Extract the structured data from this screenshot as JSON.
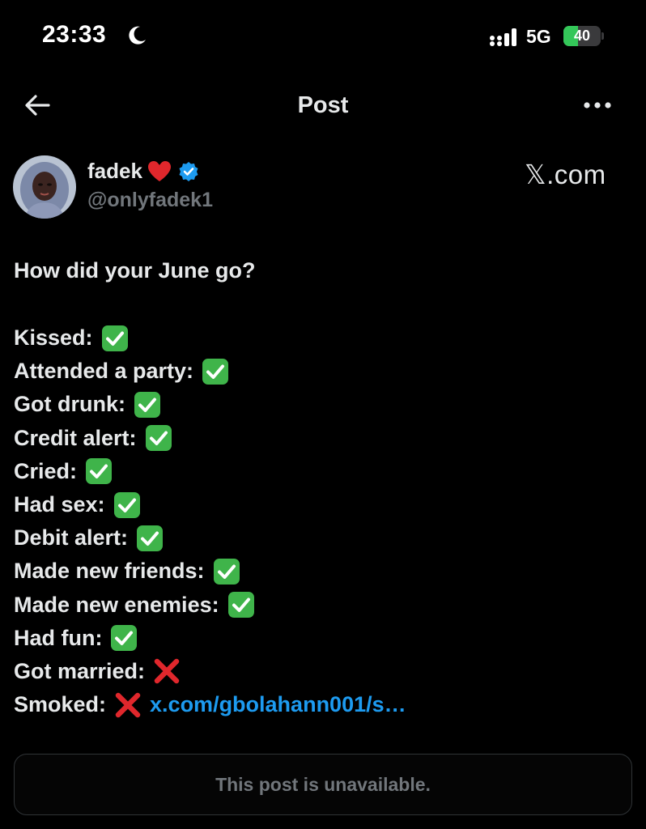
{
  "status_bar": {
    "time": "23:33",
    "network": "5G",
    "battery": "40",
    "battery_level": 0.4,
    "icons": [
      "moon-icon",
      "signal-icon",
      "battery-icon"
    ]
  },
  "nav": {
    "title": "Post",
    "icons": [
      "back-arrow-icon",
      "more-icon"
    ]
  },
  "author": {
    "name": "fadek",
    "handle": "@onlyfadek1",
    "icons": [
      "heart-icon",
      "verified-icon"
    ]
  },
  "watermark": "𝕏.com",
  "post": {
    "question": "How did your June go?",
    "items": [
      {
        "label": "Kissed:",
        "mark": "check"
      },
      {
        "label": "Attended a party:",
        "mark": "check"
      },
      {
        "label": "Got drunk:",
        "mark": "check"
      },
      {
        "label": "Credit alert:",
        "mark": "check"
      },
      {
        "label": "Cried:",
        "mark": "check"
      },
      {
        "label": "Had sex:",
        "mark": "check"
      },
      {
        "label": "Debit alert:",
        "mark": "check"
      },
      {
        "label": "Made new friends:",
        "mark": "check"
      },
      {
        "label": "Made new enemies:",
        "mark": "check"
      },
      {
        "label": "Had fun:",
        "mark": "check"
      },
      {
        "label": "Got married:",
        "mark": "cross"
      },
      {
        "label": "Smoked:",
        "mark": "cross"
      }
    ],
    "link": "x.com/gbolahann001/s…"
  },
  "quote_card": {
    "text": "This post is unavailable."
  },
  "colors": {
    "background": "#000000",
    "text": "#e7e9ea",
    "secondary": "#71767b",
    "link": "#1d9bf0",
    "check": "#3fb44a",
    "cross": "#e0272c",
    "battery": "#34c759"
  }
}
